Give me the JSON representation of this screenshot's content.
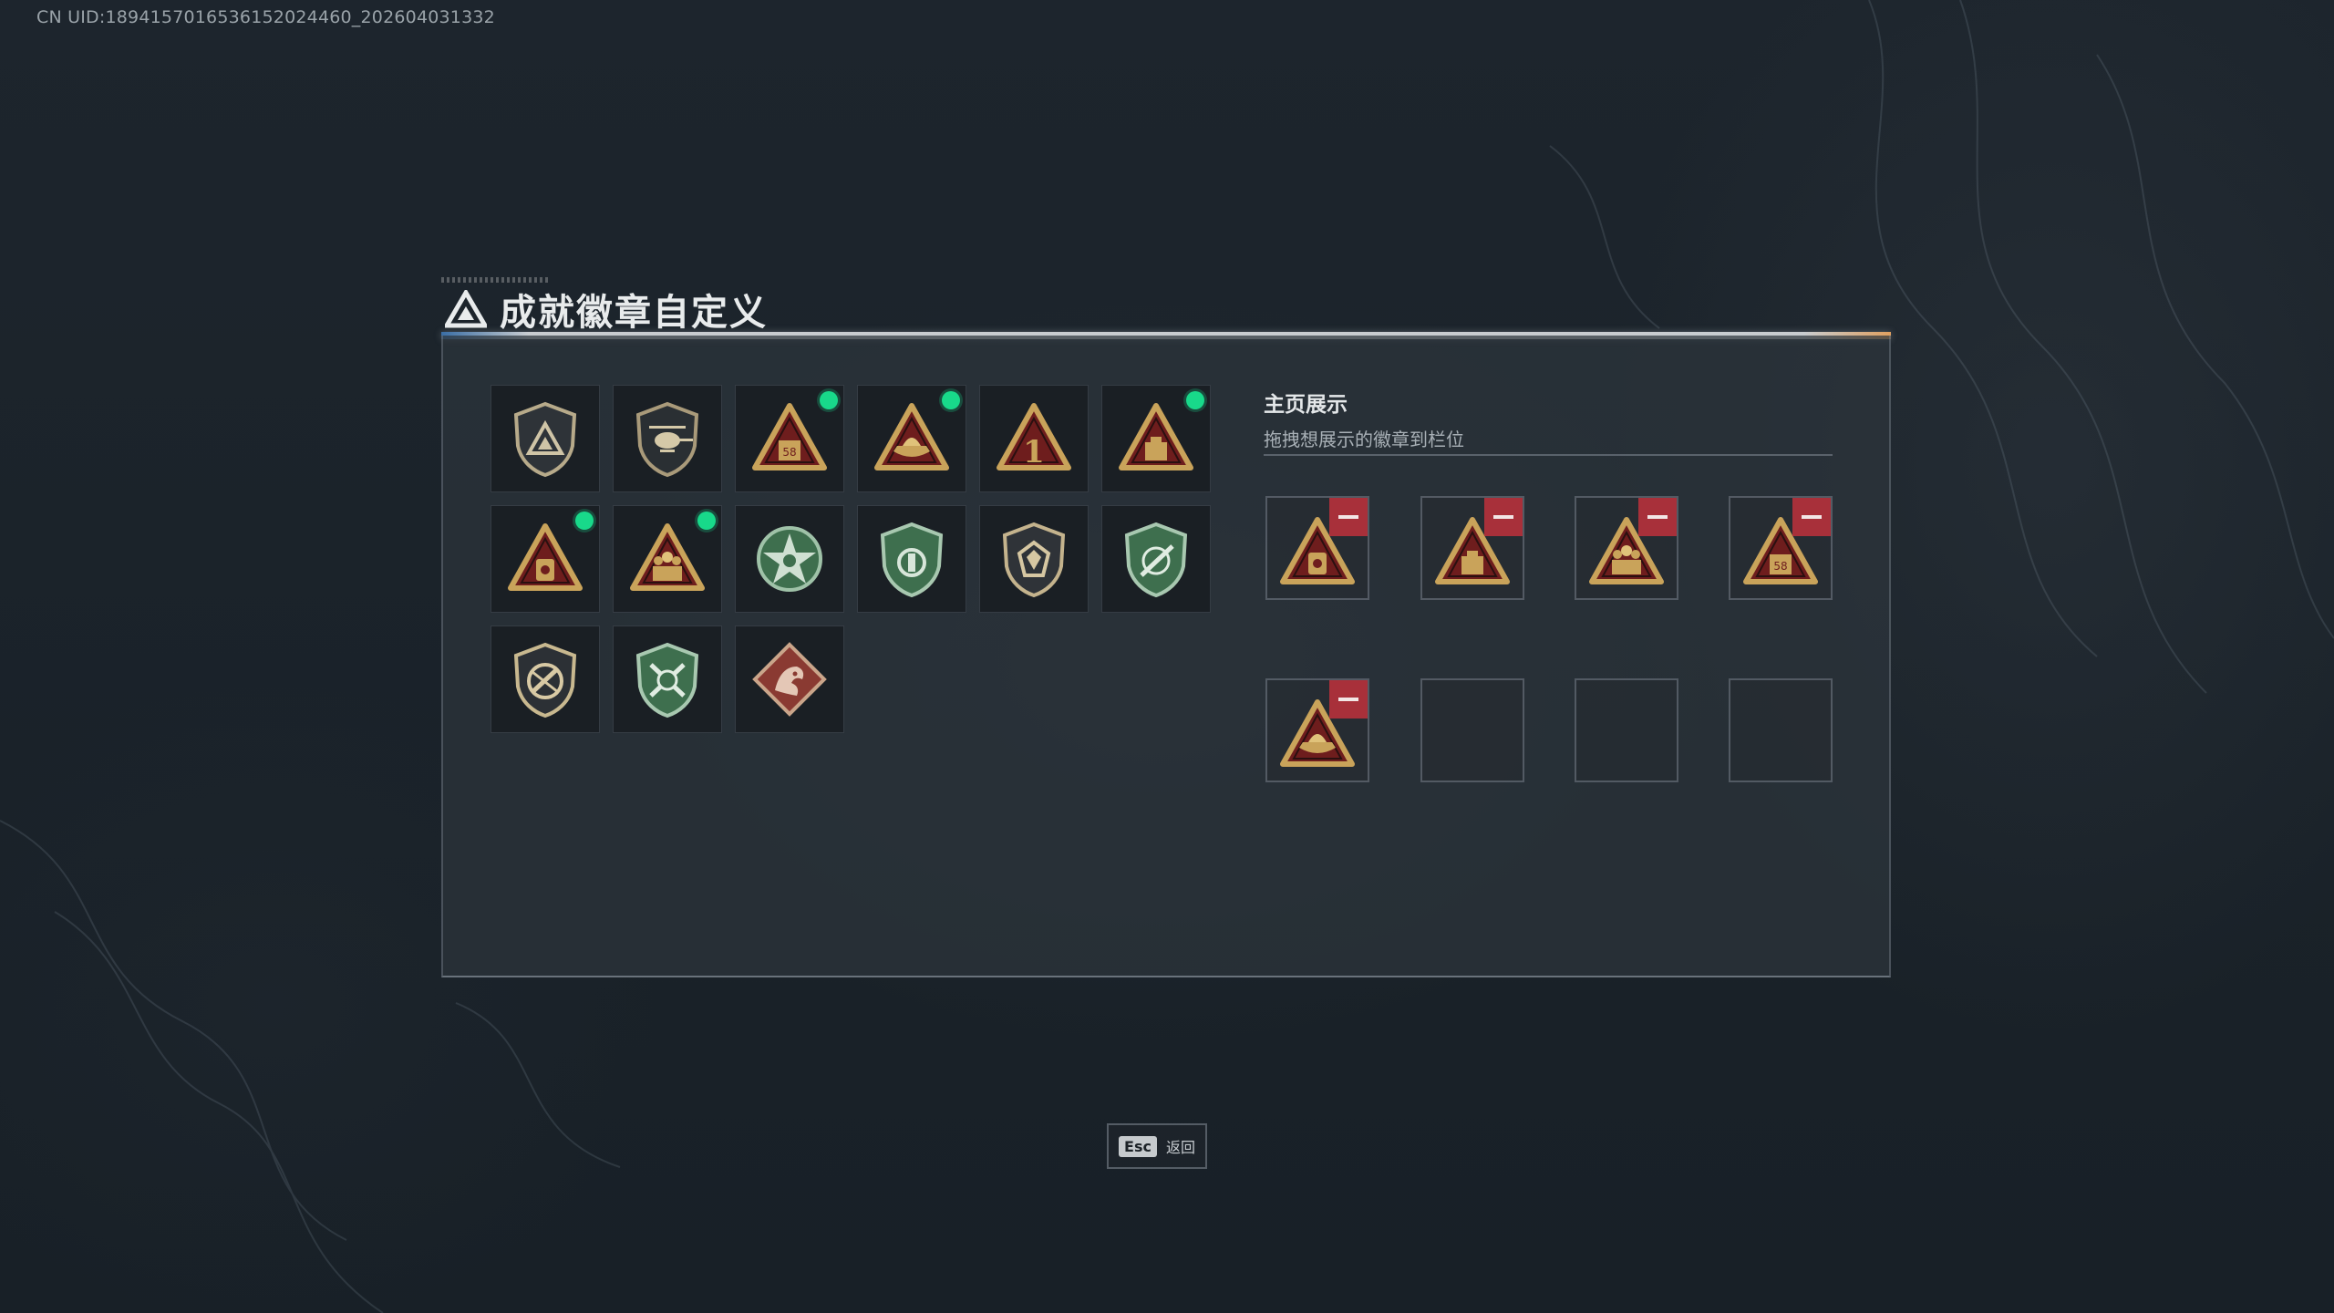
{
  "uid_text": "CN UID:1894157016536152024460_202604031332",
  "page": {
    "title": "成就徽章自定义"
  },
  "colors": {
    "new_dot": "#18d98a",
    "remove_button": "#a8303a",
    "gold": "#c9a35a",
    "dark_red": "#6e1d1d",
    "green_badge": "#3e6f4e"
  },
  "badges": [
    {
      "icon": "shield-triangle-badge-icon",
      "new": false
    },
    {
      "icon": "shield-helicopter-badge-icon",
      "new": false
    },
    {
      "icon": "triangle-58-badge-icon",
      "new": true
    },
    {
      "icon": "triangle-boat-badge-icon",
      "new": true
    },
    {
      "icon": "triangle-number-one-badge-icon",
      "new": false
    },
    {
      "icon": "triangle-box-badge-icon",
      "new": true
    },
    {
      "icon": "triangle-lantern-badge-icon",
      "new": true
    },
    {
      "icon": "triangle-soldiers-badge-icon",
      "new": true
    },
    {
      "icon": "green-star-badge-icon",
      "new": false
    },
    {
      "icon": "green-crest-badge-icon",
      "new": false
    },
    {
      "icon": "shield-gem-badge-icon",
      "new": false
    },
    {
      "icon": "green-shield-rifle-badge-icon",
      "new": false
    },
    {
      "icon": "shield-no-rifle-badge-icon",
      "new": false
    },
    {
      "icon": "green-crossed-rifles-badge-icon",
      "new": false
    },
    {
      "icon": "red-dragon-badge-icon",
      "new": false
    }
  ],
  "display": {
    "title": "主页展示",
    "subtitle": "拖拽想展示的徽章到栏位",
    "slots": [
      {
        "icon": "triangle-lantern-badge-icon",
        "filled": true
      },
      {
        "icon": "triangle-box-badge-icon",
        "filled": true
      },
      {
        "icon": "triangle-soldiers-badge-icon",
        "filled": true
      },
      {
        "icon": "triangle-58-badge-icon",
        "filled": true
      },
      {
        "icon": "triangle-boat-badge-icon",
        "filled": true
      },
      {
        "icon": "",
        "filled": false
      },
      {
        "icon": "",
        "filled": false
      },
      {
        "icon": "",
        "filled": false
      }
    ]
  },
  "footer": {
    "esc_key": "Esc",
    "esc_label": "返回"
  }
}
